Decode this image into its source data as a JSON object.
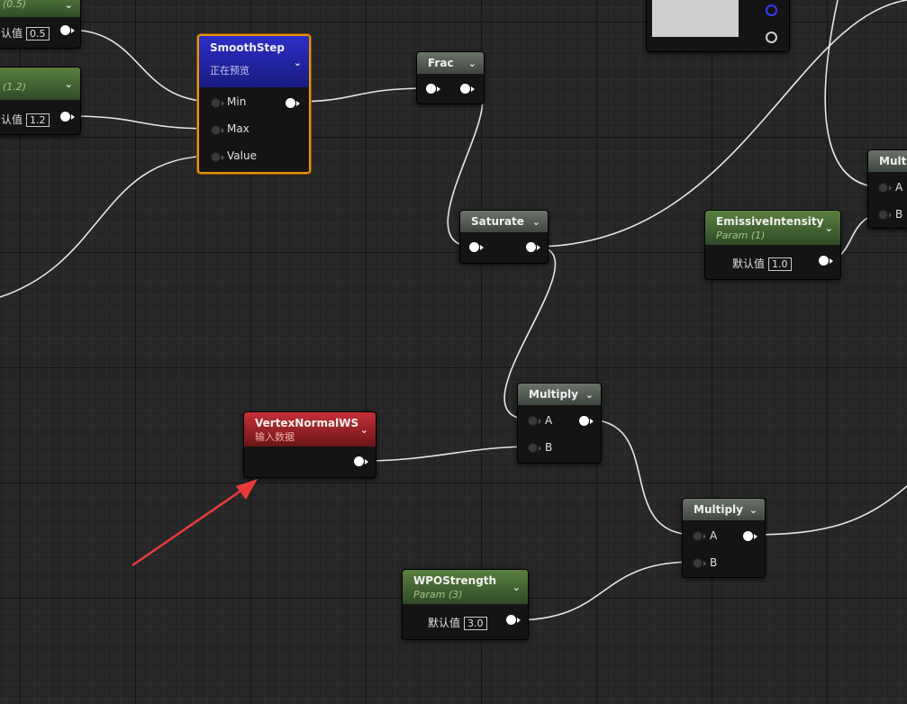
{
  "nodes": {
    "param_top": {
      "subtitle": "(0.5)",
      "default_label": "认值",
      "value": "0.5"
    },
    "param_mid": {
      "subtitle": "(1.2)",
      "default_label": "认值",
      "value": "1.2"
    },
    "smoothstep": {
      "title": "SmoothStep",
      "subtitle": "正在预览",
      "pins": [
        "Min",
        "Max",
        "Value"
      ]
    },
    "frac": {
      "title": "Frac"
    },
    "saturate": {
      "title": "Saturate"
    },
    "multiply_right": {
      "title": "Multi",
      "pins": [
        "A",
        "B"
      ]
    },
    "emissive": {
      "title": "EmissiveIntensity",
      "subtitle": "Param (1)",
      "default_label": "默认值",
      "value": "1.0"
    },
    "multiply_1": {
      "title": "Multiply",
      "pins": [
        "A",
        "B"
      ]
    },
    "vertex_normal": {
      "title": "VertexNormalWS",
      "subtitle": "输入数据"
    },
    "multiply_2": {
      "title": "Multiply",
      "pins": [
        "A",
        "B"
      ]
    },
    "wpo": {
      "title": "WPOStrength",
      "subtitle": "Param (3)",
      "default_label": "默认值",
      "value": "3.0"
    }
  },
  "colors": {
    "background": "#262626",
    "selection": "#e8940d",
    "annotation_arrow": "#e83a3a"
  },
  "icons": {
    "collapse": "chevron-down-icon",
    "annotation": "red-arrow-annotation"
  }
}
